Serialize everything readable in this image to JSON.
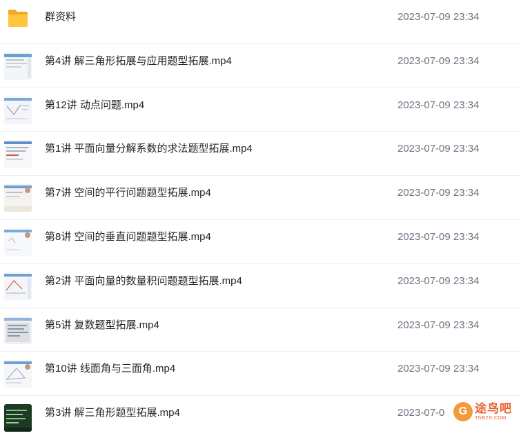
{
  "files": [
    {
      "kind": "folder",
      "thumb": "folder-icon",
      "name": "群资料",
      "date": "2023-07-09 23:34"
    },
    {
      "kind": "video",
      "thumb": "lecture-thumbnail-light",
      "name": "第4讲 解三角形拓展与应用题型拓展.mp4",
      "date": "2023-07-09 23:34"
    },
    {
      "kind": "video",
      "thumb": "lecture-thumbnail-light",
      "name": "第12讲 动点问题.mp4",
      "date": "2023-07-09 23:34"
    },
    {
      "kind": "video",
      "thumb": "lecture-thumbnail-light",
      "name": "第1讲 平面向量分解系数的求法题型拓展.mp4",
      "date": "2023-07-09 23:34"
    },
    {
      "kind": "video",
      "thumb": "lecture-thumbnail-light",
      "name": "第7讲 空间的平行问题题型拓展.mp4",
      "date": "2023-07-09 23:34"
    },
    {
      "kind": "video",
      "thumb": "lecture-thumbnail-light",
      "name": "第8讲 空间的垂直问题题型拓展.mp4",
      "date": "2023-07-09 23:34"
    },
    {
      "kind": "video",
      "thumb": "lecture-thumbnail-light",
      "name": "第2讲 平面向量的数量积问题题型拓展.mp4",
      "date": "2023-07-09 23:34"
    },
    {
      "kind": "video",
      "thumb": "lecture-thumbnail-light",
      "name": "第5讲 复数题型拓展.mp4",
      "date": "2023-07-09 23:34"
    },
    {
      "kind": "video",
      "thumb": "lecture-thumbnail-light",
      "name": "第10讲 线面角与三面角.mp4",
      "date": "2023-07-09 23:34"
    },
    {
      "kind": "video",
      "thumb": "lecture-thumbnail-dark",
      "name": "第3讲 解三角形题型拓展.mp4",
      "date": "2023-07-0"
    }
  ],
  "watermark": {
    "badge": "G",
    "main": "途鸟吧",
    "sub": "TNBZS.COM"
  },
  "colors": {
    "text": "#1f2329",
    "date": "#6b7280",
    "folder": "#f7b500",
    "accent": "#e8632b"
  }
}
